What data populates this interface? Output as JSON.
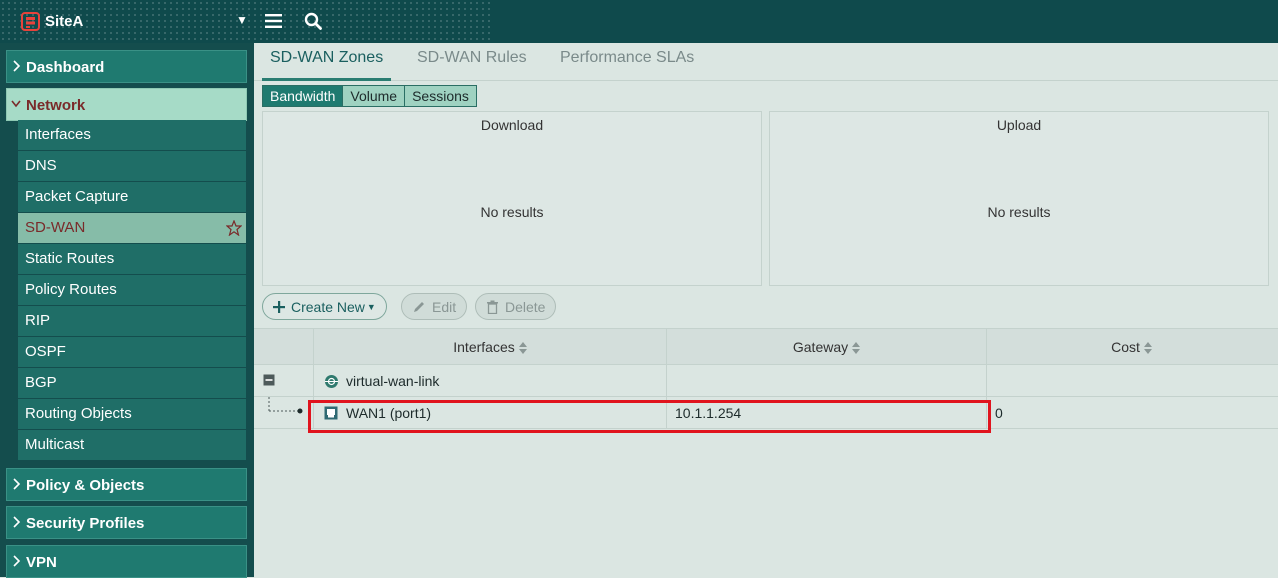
{
  "header": {
    "device_name": "SiteA",
    "icons": [
      "fortinet-logo-icon",
      "caret-down-icon",
      "hamburger-menu-icon",
      "search-icon"
    ]
  },
  "sidebar": {
    "sections": [
      {
        "label": "Dashboard",
        "expanded": false
      },
      {
        "label": "Network",
        "expanded": true
      },
      {
        "label": "Policy & Objects",
        "expanded": false
      },
      {
        "label": "Security Profiles",
        "expanded": false
      },
      {
        "label": "VPN",
        "expanded": false
      }
    ],
    "network_items": [
      {
        "label": "Interfaces"
      },
      {
        "label": "DNS"
      },
      {
        "label": "Packet Capture"
      },
      {
        "label": "SD-WAN",
        "active": true
      },
      {
        "label": "Static Routes"
      },
      {
        "label": "Policy Routes"
      },
      {
        "label": "RIP"
      },
      {
        "label": "OSPF"
      },
      {
        "label": "BGP"
      },
      {
        "label": "Routing Objects"
      },
      {
        "label": "Multicast"
      }
    ]
  },
  "tabs": [
    {
      "label": "SD-WAN Zones",
      "active": true
    },
    {
      "label": "SD-WAN Rules"
    },
    {
      "label": "Performance SLAs"
    }
  ],
  "view_toggle": [
    {
      "label": "Bandwidth",
      "active": true
    },
    {
      "label": "Volume"
    },
    {
      "label": "Sessions"
    }
  ],
  "panels": {
    "download": {
      "title": "Download",
      "message": "No results"
    },
    "upload": {
      "title": "Upload",
      "message": "No results"
    }
  },
  "toolbar": {
    "create_new": "Create New",
    "edit": "Edit",
    "delete": "Delete"
  },
  "table": {
    "columns": [
      "Interfaces",
      "Gateway",
      "Cost"
    ],
    "rows": [
      {
        "interface": "virtual-wan-link",
        "gateway": "",
        "cost": "",
        "type": "zone"
      },
      {
        "interface": "WAN1 (port1)",
        "gateway": "10.1.1.254",
        "cost": "0",
        "type": "member"
      }
    ]
  },
  "colors": {
    "topbar": "#0f4a4c",
    "sidebar": "#144d4d",
    "accent": "#1f7a70",
    "highlight_box": "#e0141e"
  }
}
